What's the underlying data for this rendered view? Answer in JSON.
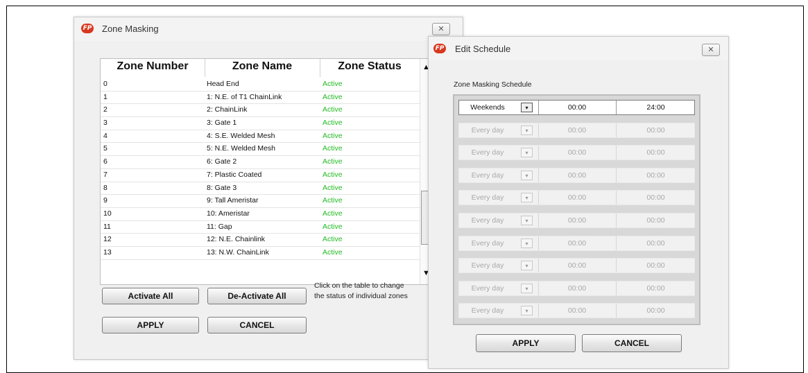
{
  "zone_window": {
    "title": "Zone Masking",
    "close_glyph": "✕",
    "table": {
      "headers": [
        "Zone Number",
        "Zone Name",
        "Zone Status"
      ],
      "rows": [
        {
          "num": "0",
          "name": "Head End",
          "status": "Active"
        },
        {
          "num": "1",
          "name": "1: N.E. of T1 ChainLink",
          "status": "Active"
        },
        {
          "num": "2",
          "name": "2: ChainLink",
          "status": "Active"
        },
        {
          "num": "3",
          "name": "3: Gate 1",
          "status": "Active"
        },
        {
          "num": "4",
          "name": "4: S.E. Welded Mesh",
          "status": "Active"
        },
        {
          "num": "5",
          "name": "5: N.E. Welded Mesh",
          "status": "Active"
        },
        {
          "num": "6",
          "name": "6: Gate 2",
          "status": "Active"
        },
        {
          "num": "7",
          "name": "7: Plastic Coated",
          "status": "Active"
        },
        {
          "num": "8",
          "name": "8: Gate 3",
          "status": "Active"
        },
        {
          "num": "9",
          "name": "9: Tall Ameristar",
          "status": "Active"
        },
        {
          "num": "10",
          "name": "10: Ameristar",
          "status": "Active"
        },
        {
          "num": "11",
          "name": "11: Gap",
          "status": "Active"
        },
        {
          "num": "12",
          "name": "12: N.E. Chainlink",
          "status": "Active"
        },
        {
          "num": "13",
          "name": "13: N.W. ChainLink",
          "status": "Active"
        }
      ],
      "scroll_up": "▲",
      "scroll_down": "▼"
    },
    "buttons": {
      "activate_all": "Activate All",
      "deactivate_all": "De-Activate All",
      "apply": "APPLY",
      "cancel": "CANCEL"
    },
    "hint_line1": "Click on the table to change",
    "hint_line2": "the status of individual zones"
  },
  "schedule_window": {
    "title": "Edit Schedule",
    "close_glyph": "✕",
    "section_label": "Zone Masking Schedule",
    "rows": [
      {
        "day": "Weekends",
        "start": "00:00",
        "end": "24:00",
        "enabled": true
      },
      {
        "day": "Every day",
        "start": "00:00",
        "end": "00:00",
        "enabled": false
      },
      {
        "day": "Every day",
        "start": "00:00",
        "end": "00:00",
        "enabled": false
      },
      {
        "day": "Every day",
        "start": "00:00",
        "end": "00:00",
        "enabled": false
      },
      {
        "day": "Every day",
        "start": "00:00",
        "end": "00:00",
        "enabled": false
      },
      {
        "day": "Every day",
        "start": "00:00",
        "end": "00:00",
        "enabled": false
      },
      {
        "day": "Every day",
        "start": "00:00",
        "end": "00:00",
        "enabled": false
      },
      {
        "day": "Every day",
        "start": "00:00",
        "end": "00:00",
        "enabled": false
      },
      {
        "day": "Every day",
        "start": "00:00",
        "end": "00:00",
        "enabled": false
      },
      {
        "day": "Every day",
        "start": "00:00",
        "end": "00:00",
        "enabled": false
      }
    ],
    "dropdown_glyph": "▾",
    "buttons": {
      "apply": "APPLY",
      "cancel": "CANCEL"
    }
  },
  "brand": {
    "logo_text": "FP",
    "logo_color": "#d9381e",
    "active_color": "#22bb22"
  }
}
